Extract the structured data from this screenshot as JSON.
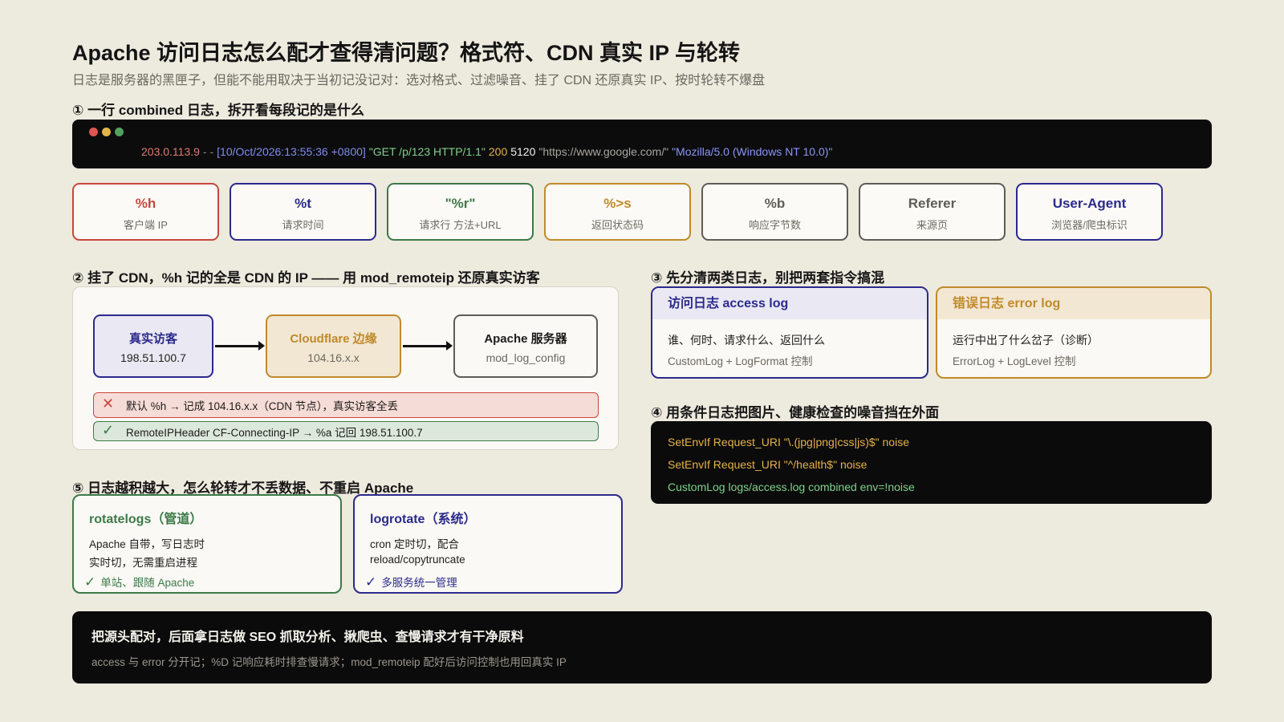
{
  "title": "Apache 访问日志怎么配才查得清问题？格式符、CDN 真实 IP 与轮转",
  "subtitle": "日志是服务器的黑匣子，但能不能用取决于当初记没记对：选对格式、过滤噪音、挂了 CDN 还原真实 IP、按时轮转不爆盘",
  "section1": {
    "heading": "① 一行 combined 日志，拆开看每段记的是什么",
    "log_parts": [
      {
        "text": "203.0.113.9",
        "color": "#e07a6e"
      },
      {
        "text": "- -",
        "color": "#8a877f"
      },
      {
        "text": "[10/Oct/2026:13:55:36 +0800]",
        "color": "#7f8cf0"
      },
      {
        "text": "\"GET /p/123 HTTP/1.1\"",
        "color": "#7fd18b"
      },
      {
        "text": "200",
        "color": "#e6b24a"
      },
      {
        "text": "5120",
        "color": "#f2f2f2"
      },
      {
        "text": "\"https://www.google.com/\"",
        "color": "#a9a6a0"
      },
      {
        "text": "\"Mozilla/5.0 (Windows NT 10.0)\"",
        "color": "#8a96f4"
      }
    ],
    "chips": [
      {
        "key": "%h",
        "desc": "客户端 IP",
        "color": "#c8473c"
      },
      {
        "key": "%t",
        "desc": "请求时间",
        "color": "#2b2a8c"
      },
      {
        "key": "\"%r\"",
        "desc": "请求行 方法+URL",
        "color": "#3c7a48"
      },
      {
        "key": "%>s",
        "desc": "返回状态码",
        "color": "#c08a2a"
      },
      {
        "key": "%b",
        "desc": "响应字节数",
        "color": "#5e5c56"
      },
      {
        "key": "Referer",
        "desc": "来源页",
        "color": "#5e5c56"
      },
      {
        "key": "User-Agent",
        "desc": "浏览器/爬虫标识",
        "color": "#2b2a8c"
      }
    ]
  },
  "section2": {
    "heading": "② 挂了 CDN，%h 记的全是 CDN 的 IP —— 用 mod_remoteip 还原真实访客",
    "nodes": [
      {
        "name": "真实访客",
        "sub": "198.51.100.7"
      },
      {
        "name": "Cloudflare 边缘",
        "sub": "104.16.x.x"
      },
      {
        "name": "Apache 服务器",
        "sub": "mod_log_config"
      }
    ],
    "bad_icon": "cross-icon",
    "bad_text": "默认 %h → 记成 104.16.x.x（CDN 节点），真实访客全丢",
    "good_icon": "check-icon",
    "good_text": "RemoteIPHeader CF-Connecting-IP → %a 记回 198.51.100.7"
  },
  "section3": {
    "heading": "③ 先分清两类日志，别把两套指令搞混",
    "access": {
      "title": "访问日志 access log",
      "line1": "谁、何时、请求什么、返回什么",
      "line2": "CustomLog + LogFormat 控制"
    },
    "error": {
      "title": "错误日志 error log",
      "line1": "运行中出了什么岔子（诊断）",
      "line2": "ErrorLog + LogLevel 控制"
    }
  },
  "section4": {
    "heading": "④ 用条件日志把图片、健康检查的噪音挡在外面",
    "code_lines": [
      {
        "text": "SetEnvIf Request_URI \"\\.(jpg|png|css|js)$\" noise",
        "color": "#e6b24a"
      },
      {
        "text": "SetEnvIf Request_URI \"^/health$\" noise",
        "color": "#e6b24a"
      },
      {
        "text": "CustomLog logs/access.log combined env=!noise",
        "color": "#7fd18b"
      }
    ]
  },
  "section5": {
    "heading": "⑤ 日志越积越大，怎么轮转才不丢数据、不重启 Apache",
    "rotatelogs": {
      "title": "rotatelogs（管道）",
      "line1": "Apache 自带，写日志时",
      "line2": "实时切，无需重启进程",
      "footer": "单站、跟随 Apache"
    },
    "logrotate": {
      "title": "logrotate（系统）",
      "line1": "cron 定时切，配合",
      "line2": "reload/copytruncate",
      "footer": "多服务统一管理"
    }
  },
  "footer": {
    "line1": "把源头配对，后面拿日志做 SEO 抓取分析、揪爬虫、查慢请求才有干净原料",
    "line2": "access 与 error 分开记；%D 记响应耗时排查慢请求；mod_remoteip 配好后访问控制也用回真实 IP"
  },
  "colors": {
    "background": "#edeade",
    "dark": "#0b0b0c",
    "red": "#c8473c",
    "navy": "#2b2a8c",
    "green": "#3c7a48",
    "gold": "#c08a2a"
  }
}
